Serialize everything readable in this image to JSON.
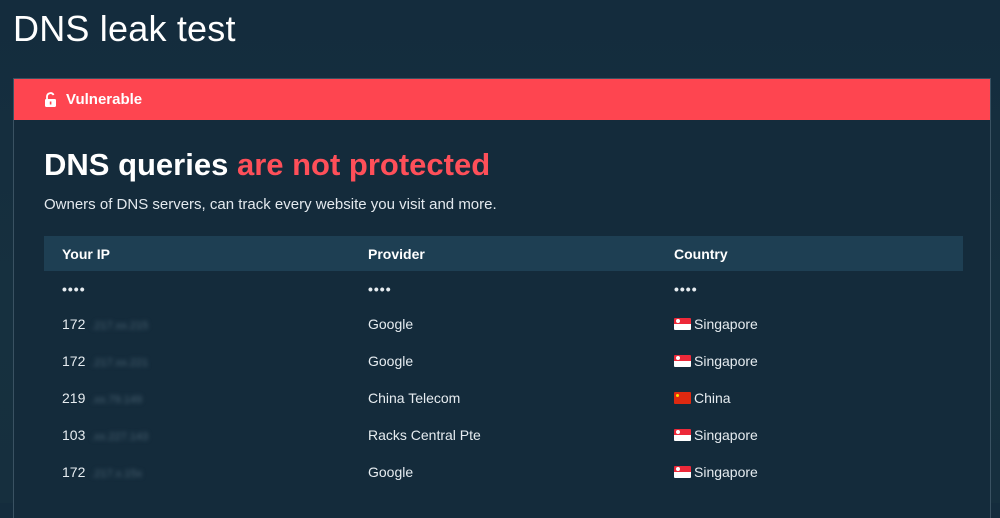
{
  "page": {
    "title": "DNS leak test"
  },
  "status": {
    "label": "Vulnerable",
    "icon": "unlock-icon",
    "color": "#fe4550"
  },
  "result": {
    "headline_prefix": "DNS queries ",
    "headline_accent": "are not protected",
    "accent_color": "#fe4f59",
    "description": "Owners of DNS servers, can track every website you visit and more."
  },
  "table": {
    "headers": [
      "Your IP",
      "Provider",
      "Country"
    ],
    "masked": "••••",
    "rows": [
      {
        "ip_prefix": "172",
        "ip_rest": ".217.xx.215",
        "provider": "Google",
        "country": "Singapore",
        "flag": "singapore-flag-icon"
      },
      {
        "ip_prefix": "172",
        "ip_rest": ".217.xx.221",
        "provider": "Google",
        "country": "Singapore",
        "flag": "singapore-flag-icon"
      },
      {
        "ip_prefix": "219",
        "ip_rest": ".xx.79.149",
        "provider": "China Telecom",
        "country": "China",
        "flag": "china-flag-icon"
      },
      {
        "ip_prefix": "103",
        "ip_rest": ".xx.227.143",
        "provider": "Racks Central Pte",
        "country": "Singapore",
        "flag": "singapore-flag-icon"
      },
      {
        "ip_prefix": "172",
        "ip_rest": ".217.x.15x",
        "provider": "Google",
        "country": "Singapore",
        "flag": "singapore-flag-icon"
      }
    ]
  }
}
